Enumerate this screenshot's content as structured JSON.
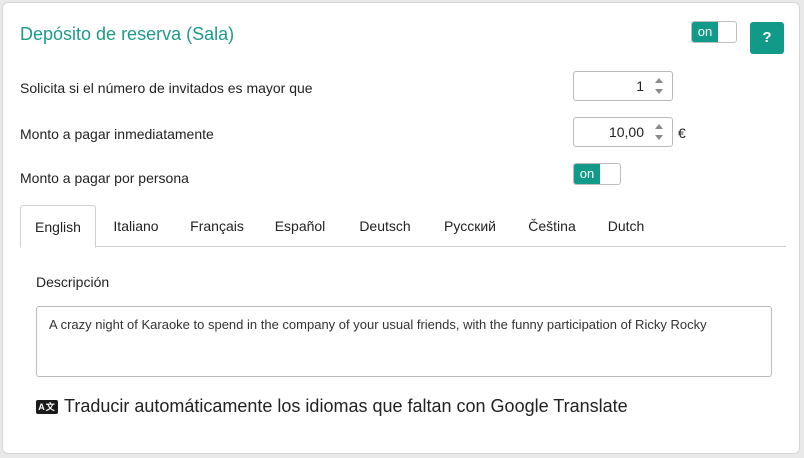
{
  "header": {
    "title": "Depósito de reserva (Sala)",
    "toggle_label": "on",
    "help_label": "?"
  },
  "rows": {
    "guests_label": "Solicita si el número de invitados es mayor que",
    "guests_value": "1",
    "amount_label": "Monto a pagar inmediatamente",
    "amount_value": "10,00",
    "currency": "€",
    "per_person_label": "Monto a pagar por persona",
    "per_person_toggle": "on"
  },
  "tabs": [
    "English",
    "Italiano",
    "Français",
    "Español",
    "Deutsch",
    "Русский",
    "Čeština",
    "Dutch"
  ],
  "description": {
    "label": "Descripción",
    "text": "A crazy night of Karaoke to spend in the company of your usual friends, with the funny participation of Ricky Rocky"
  },
  "translate": {
    "label": "Traducir automáticamente los idiomas que faltan con Google Translate",
    "icon": "translate-icon"
  },
  "colors": {
    "accent": "#129a88",
    "title": "#1e9a8a"
  }
}
